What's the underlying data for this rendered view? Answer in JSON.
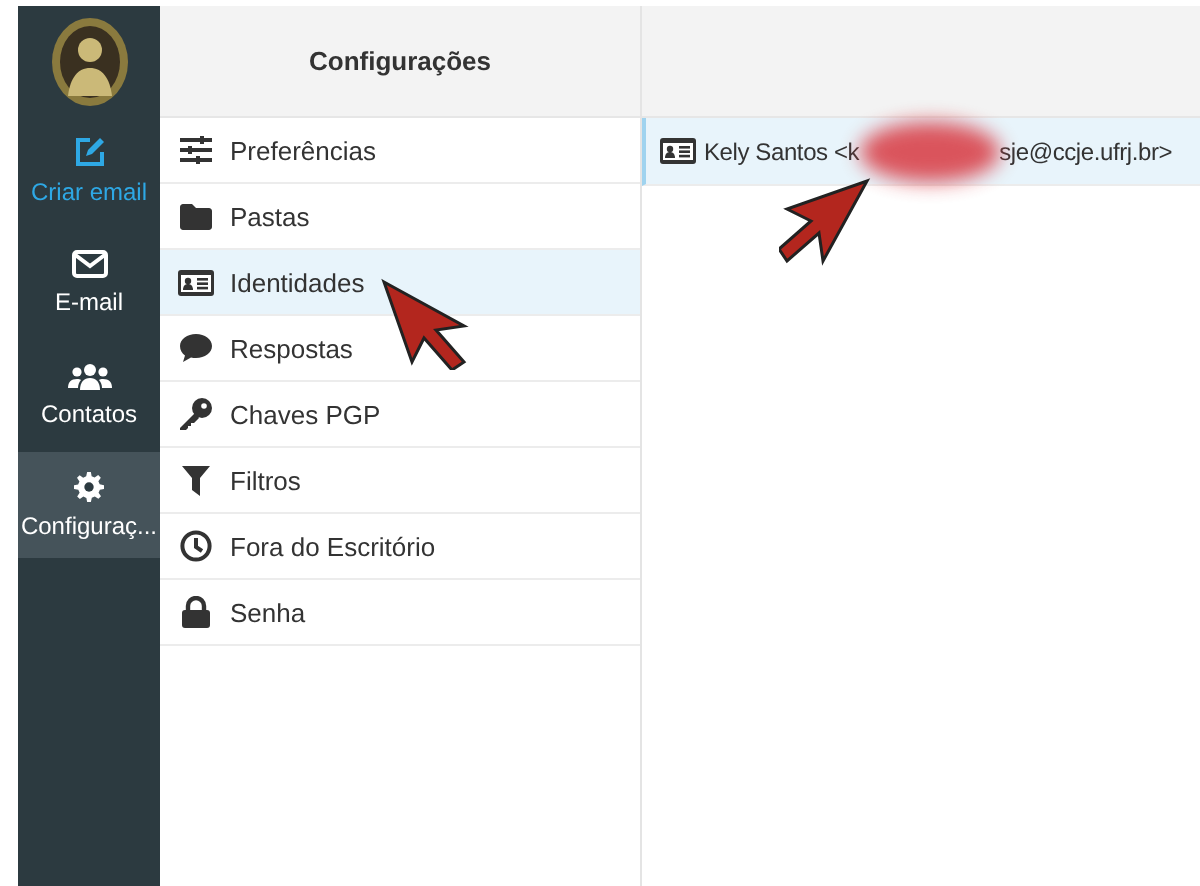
{
  "nav": [
    {
      "label": "Criar email",
      "kind": "compose",
      "selected": false,
      "highlight": true
    },
    {
      "label": "E-mail",
      "kind": "mail",
      "selected": false,
      "highlight": false
    },
    {
      "label": "Contatos",
      "kind": "contacts",
      "selected": false,
      "highlight": false
    },
    {
      "label": "Configuraç...",
      "kind": "settings",
      "selected": true,
      "highlight": false
    }
  ],
  "settings": {
    "title": "Configurações",
    "items": [
      {
        "label": "Preferências",
        "kind": "sliders",
        "selected": false
      },
      {
        "label": "Pastas",
        "kind": "folder",
        "selected": false
      },
      {
        "label": "Identidades",
        "kind": "idcard",
        "selected": true
      },
      {
        "label": "Respostas",
        "kind": "comment",
        "selected": false
      },
      {
        "label": "Chaves PGP",
        "kind": "key",
        "selected": false
      },
      {
        "label": "Filtros",
        "kind": "filter",
        "selected": false
      },
      {
        "label": "Fora do Escritório",
        "kind": "clock",
        "selected": false
      },
      {
        "label": "Senha",
        "kind": "lock",
        "selected": false
      }
    ]
  },
  "identities": [
    {
      "name": "Kely Santos",
      "email_start": "<k",
      "redacted": true,
      "email_end": "sje@ccje.ufrj.br>",
      "selected": true
    }
  ],
  "annotations": [
    {
      "kind": "arrow"
    },
    {
      "kind": "arrow"
    }
  ]
}
